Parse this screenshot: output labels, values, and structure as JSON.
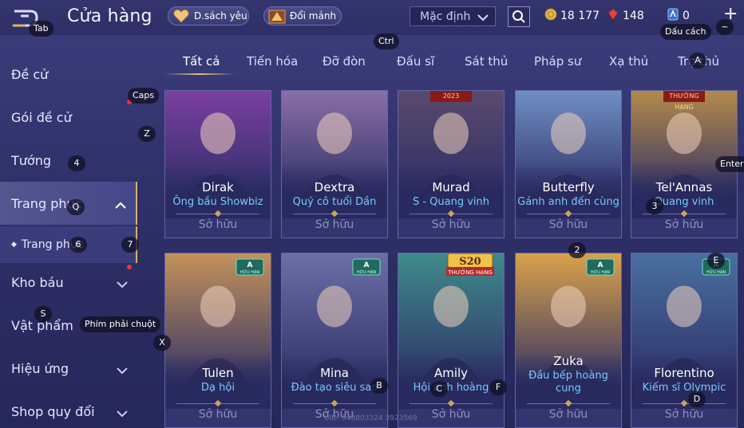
{
  "header": {
    "title": "Cửa hàng",
    "favorites_label": "D.sách yêu",
    "shard_label": "Đổi mảnh",
    "sort_value": "Mặc định",
    "gold": "18 177",
    "ruby": "148",
    "voucher": "0",
    "plus": "+"
  },
  "sidebar": {
    "items": [
      {
        "label": "Đề cử"
      },
      {
        "label": "Gói đề cử"
      },
      {
        "label": "Tướng"
      },
      {
        "label": "Trang phục"
      },
      {
        "label": "Trang phục"
      },
      {
        "label": "Kho báu"
      },
      {
        "label": "Vật phẩm"
      },
      {
        "label": "Hiệu ứng"
      },
      {
        "label": "Shop quy đổi"
      }
    ]
  },
  "tabs": [
    {
      "label": "Tất cả"
    },
    {
      "label": "Tiến hóa"
    },
    {
      "label": "Đỡ đòn"
    },
    {
      "label": "Đấu sĩ"
    },
    {
      "label": "Sát thủ"
    },
    {
      "label": "Pháp sư"
    },
    {
      "label": "Xạ thủ"
    },
    {
      "label": "Trợ thủ"
    }
  ],
  "cards": [
    {
      "hero": "Dirak",
      "skin": "Ông bầu Showbiz",
      "status": "Sở hữu",
      "badge": "",
      "art_color": "#7b3fa0"
    },
    {
      "hero": "Dextra",
      "skin": "Quý cô tuổi Dần",
      "status": "Sở hữu",
      "badge": "",
      "art_color": "#8a6fa6"
    },
    {
      "hero": "Murad",
      "skin": "S - Quang vinh",
      "status": "Sở hữu",
      "badge": "2023",
      "art_color": "#5a4a6e"
    },
    {
      "hero": "Butterfly",
      "skin": "Gánh anh đến cùng",
      "status": "Sở hữu",
      "badge": "",
      "art_color": "#6f8fc4"
    },
    {
      "hero": "Tel'Annas",
      "skin": "Quang vinh",
      "status": "Sở hữu",
      "badge": "THƯỞNG HẠNG",
      "art_color": "#b48a4a"
    },
    {
      "hero": "Tulen",
      "skin": "Dạ hội",
      "status": "Sở hữu",
      "badge": "A",
      "badge_sub": "HỮU HẠN",
      "art_color": "#c4925a"
    },
    {
      "hero": "Mina",
      "skin": "Đào tạo siêu sao",
      "status": "Sở hữu",
      "badge": "A",
      "badge_sub": "HỮU HẠN",
      "art_color": "#6b6fa6"
    },
    {
      "hero": "Amily",
      "skin": "Hội ảnh hoàng",
      "status": "Sở hữu",
      "badge": "S20",
      "badge_sub": "THƯỞNG HẠNG",
      "art_color": "#3f8a8a"
    },
    {
      "hero": "Zuka",
      "skin": "Đầu bếp hoàng cung",
      "status": "Sở hữu",
      "badge": "A",
      "badge_sub": "HỮU HẠN",
      "art_color": "#d9a14a"
    },
    {
      "hero": "Florentino",
      "skin": "Kiếm sĩ Olympic",
      "status": "Sở hữu",
      "badge": "A",
      "badge_sub": "HỮU HẠN",
      "art_color": "#4a6fa0"
    }
  ],
  "hints": {
    "tab": "Tab",
    "ctrl": "Ctrl",
    "space": "Dấu cách",
    "tilde": "~",
    "caps": "Caps",
    "enter": "Enter",
    "right_click": "Phím phải chuột",
    "k_a": "A",
    "k_z": "Z",
    "k_4": "4",
    "k_q": "Q",
    "k_6": "6",
    "k_7": "7",
    "k_3": "3",
    "k_2": "2",
    "k_e": "E",
    "k_s": "S",
    "k_x": "X",
    "k_b": "B",
    "k_c": "C",
    "k_f": "F",
    "k_d": "D"
  },
  "footer": {
    "uid": "UID: 548803324 3923569"
  },
  "colors": {
    "accent_gold": "#d6b469",
    "skin_name_blue": "#78c8ff",
    "notification_red": "#e53535"
  }
}
